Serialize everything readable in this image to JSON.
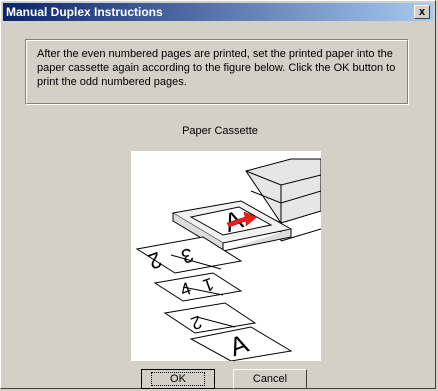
{
  "window": {
    "title": "Manual Duplex Instructions",
    "close_label": "x"
  },
  "instructions": "After the even numbered pages are printed, set the printed paper into the paper cassette again according to the figure below. Click the OK button to print the odd numbered pages.",
  "figure": {
    "caption": "Paper Cassette",
    "page_labels": [
      "A",
      "2",
      "3",
      "4",
      "1",
      "2",
      "A"
    ]
  },
  "buttons": {
    "ok": "OK",
    "cancel": "Cancel"
  },
  "colors": {
    "title_start": "#0a246a",
    "title_end": "#a6caf0",
    "arrow": "#e8201c"
  }
}
